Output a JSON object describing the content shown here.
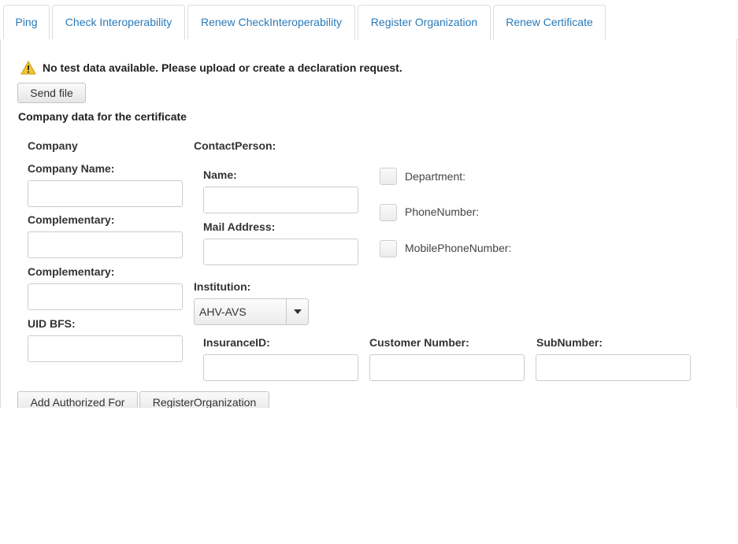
{
  "tabs": [
    {
      "label": "Ping"
    },
    {
      "label": "Check Interoperability"
    },
    {
      "label": "Renew CheckInteroperability"
    },
    {
      "label": "Register Organization"
    },
    {
      "label": "Renew Certificate"
    }
  ],
  "active_tab": "Register Organization",
  "warning": {
    "icon": "warning-icon",
    "text": "No test data available. Please upload or create a declaration request."
  },
  "send_file_label": "Send file",
  "section_title": "Company data for the certificate",
  "company": {
    "heading": "Company",
    "name_label": "Company Name:",
    "name_value": "",
    "complementary1_label": "Complementary:",
    "complementary1_value": "",
    "complementary2_label": "Complementary:",
    "complementary2_value": "",
    "uid_label": "UID BFS:",
    "uid_value": ""
  },
  "contact": {
    "heading": "ContactPerson:",
    "name_label": "Name:",
    "name_value": "",
    "mail_label": "Mail Address:",
    "mail_value": "",
    "options": [
      {
        "label": "Department:"
      },
      {
        "label": "PhoneNumber:"
      },
      {
        "label": "MobilePhoneNumber:"
      }
    ]
  },
  "institution": {
    "label": "Institution:",
    "selected": "AHV-AVS",
    "insurance_label": "InsuranceID:",
    "insurance_value": "",
    "customer_label": "Customer Number:",
    "customer_value": "",
    "sub_label": "SubNumber:",
    "sub_value": ""
  },
  "buttons": {
    "add_authorized": "Add Authorized For",
    "register": "RegisterOrganization"
  },
  "colors": {
    "tab_text": "#2a7ab8",
    "warning_fill": "#f3c52d"
  }
}
